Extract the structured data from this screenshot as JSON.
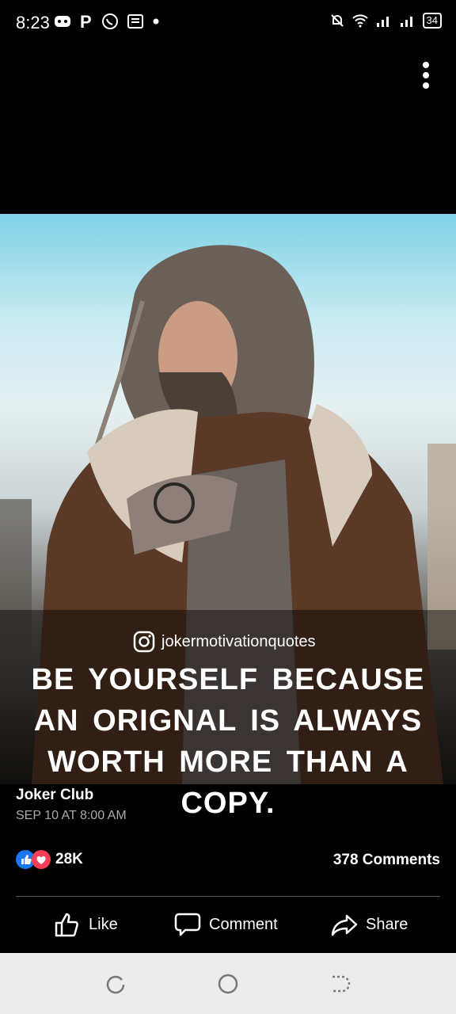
{
  "status": {
    "time": "8:23",
    "battery": "34"
  },
  "image": {
    "instagram_handle": "jokermotivationquotes",
    "quote_lines": [
      "BE YOURSELF BECAUSE",
      "AN ORIGNAL IS ALWAYS",
      "WORTH MORE THAN A COPY."
    ]
  },
  "post": {
    "author": "Joker Club",
    "date": "SEP 10 AT 8:00 AM",
    "reaction_count": "28K",
    "comments_count": "378 Comments"
  },
  "actions": {
    "like": "Like",
    "comment": "Comment",
    "share": "Share"
  },
  "colors": {
    "like_blue": "#1877f2",
    "love_red": "#f33e58",
    "nav_bg": "#ececec"
  }
}
